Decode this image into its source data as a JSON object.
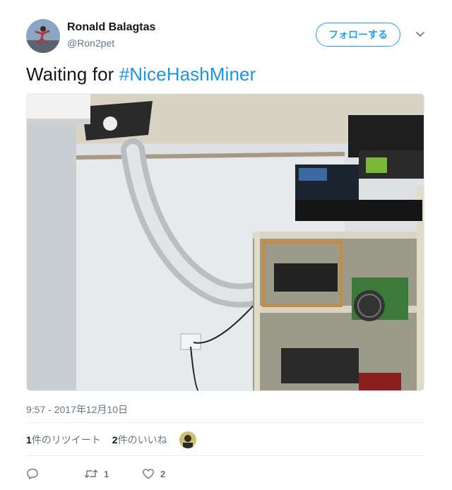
{
  "user": {
    "name": "Ronald Balagtas",
    "handle": "@Ron2pet"
  },
  "follow_label": "フォローする",
  "tweet": {
    "text_prefix": "Waiting for ",
    "hashtag": "#NiceHashMiner"
  },
  "timestamp": "9:57 - 2017年12月10日",
  "stats": {
    "retweets_count": "1",
    "retweets_label": "件のリツイート",
    "likes_count": "2",
    "likes_label": "件のいいね"
  },
  "actions": {
    "retweet_count": "1",
    "like_count": "2"
  },
  "colors": {
    "accent": "#1da1f2",
    "hashtag": "#1b95e0",
    "muted": "#657786"
  },
  "icons": {
    "caret": "chevron-down-icon",
    "reply": "reply-icon",
    "retweet": "retweet-icon",
    "like": "heart-icon"
  }
}
